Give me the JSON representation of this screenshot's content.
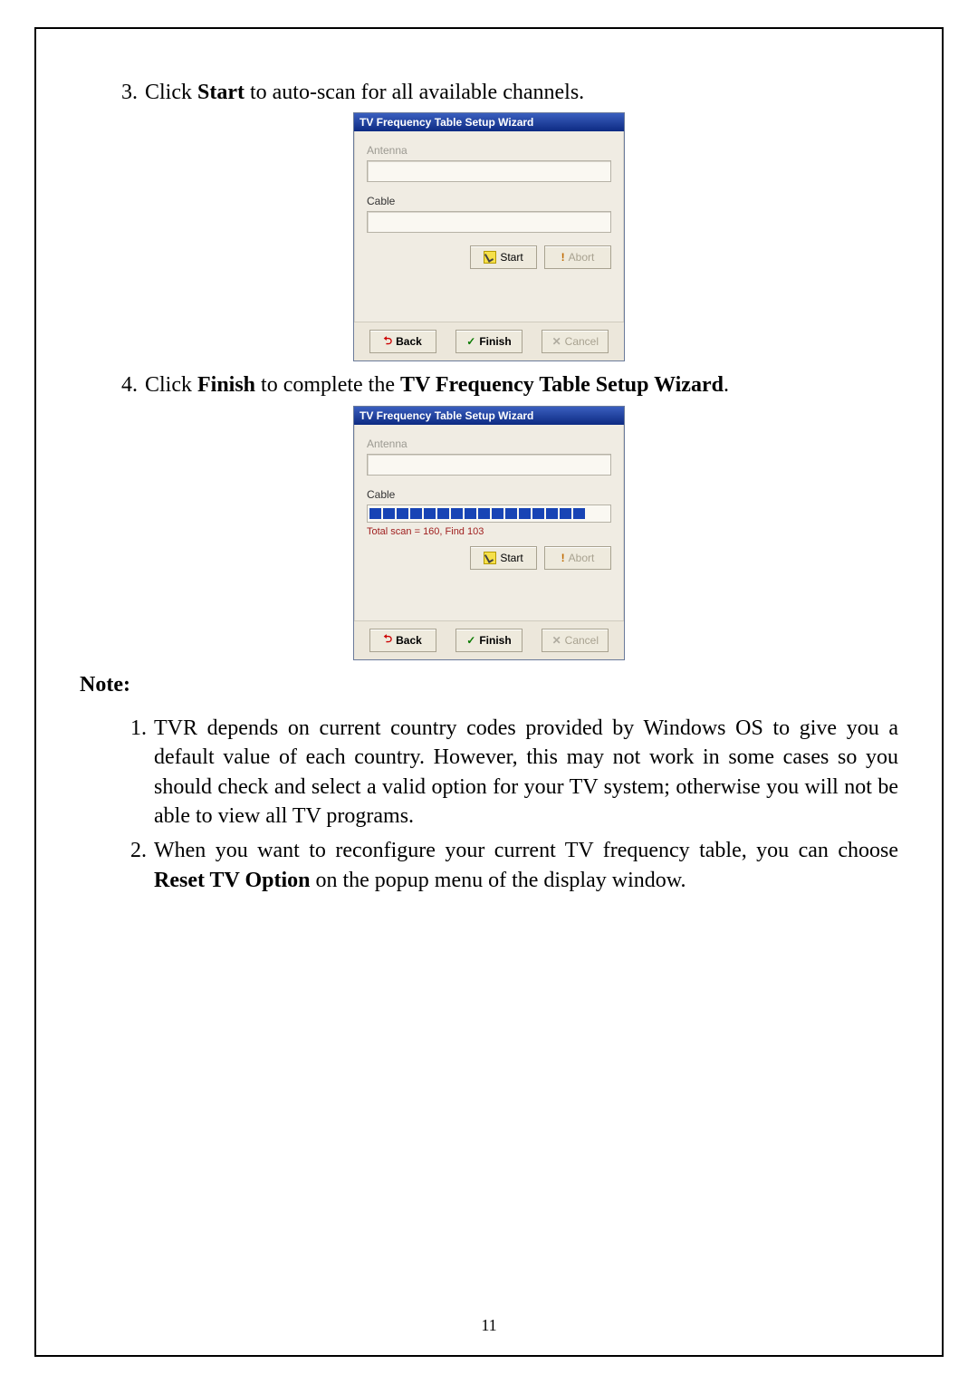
{
  "steps": {
    "s3_num": "3.",
    "s3_pre": "Click ",
    "s3_bold": "Start",
    "s3_post": " to auto-scan for all available channels.",
    "s4_num": "4.",
    "s4_pre": "Click ",
    "s4_bold1": "Finish",
    "s4_mid": " to complete the ",
    "s4_bold2": "TV Frequency Table Setup Wizard",
    "s4_post": "."
  },
  "wizard": {
    "title": "TV Frequency Table Setup Wizard",
    "antenna_label": "Antenna",
    "cable_label": "Cable",
    "scan_status": "Total scan = 160, Find 103",
    "start": "Start",
    "abort": "Abort",
    "back": "Back",
    "finish": "Finish",
    "cancel": "Cancel"
  },
  "note": {
    "header": "Note:",
    "n1_num": "1.",
    "n1_text": "TVR depends on current country codes provided by Windows OS to give you a default value of each country. However, this may not work in some cases so you should check and select a valid option for your TV system; otherwise you will not be able to view all TV programs.",
    "n2_num": "2.",
    "n2_pre": "When you want to reconfigure your current TV frequency table, you can choose ",
    "n2_bold": "Reset TV Option",
    "n2_post": " on the popup menu of the display window."
  },
  "page_number": "11"
}
